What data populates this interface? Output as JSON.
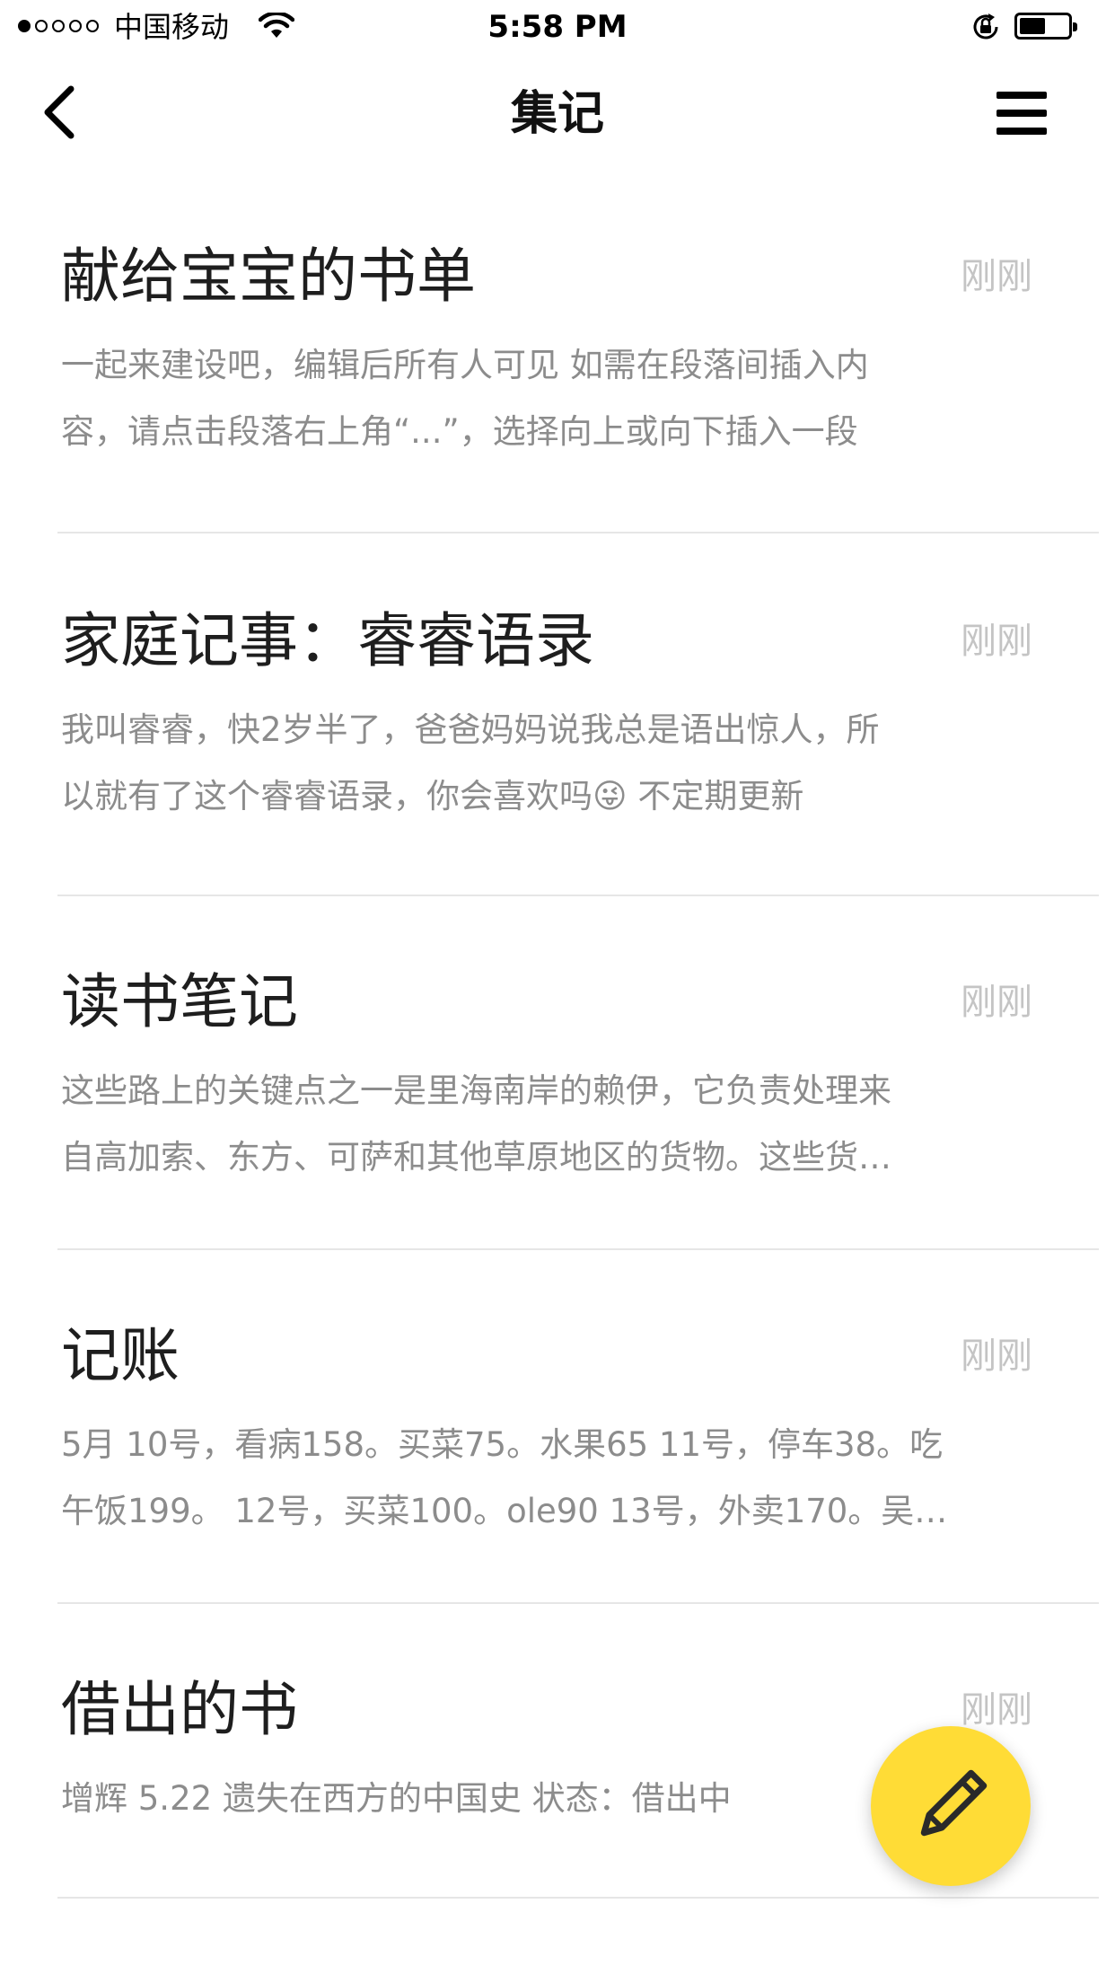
{
  "status_bar": {
    "carrier": "中国移动",
    "time": "5:58 PM"
  },
  "nav": {
    "title": "集记"
  },
  "notes": [
    {
      "title": "献给宝宝的书单",
      "time": "刚刚",
      "excerpt_lines": [
        "一起来建设吧，编辑后所有人可见 如需在段落间插入内",
        "容，请点击段落右上角“...”，选择向上或向下插入一段"
      ]
    },
    {
      "title": "家庭记事：睿睿语录",
      "time": "刚刚",
      "excerpt_lines": [
        "我叫睿睿，快2岁半了，爸爸妈妈说我总是语出惊人，所",
        "以就有了这个睿睿语录，你会喜欢吗😜 不定期更新"
      ]
    },
    {
      "title": "读书笔记",
      "time": "刚刚",
      "excerpt_lines": [
        "这些路上的关键点之一是里海南岸的赖伊，它负责处理来",
        "自高加索、东方、可萨和其他草原地区的货物。这些货…"
      ]
    },
    {
      "title": "记账",
      "time": "刚刚",
      "excerpt_lines": [
        "5月 10号，看病158。买菜75。水果65 11号，停车38。吃",
        "午饭199。 12号，买菜100。ole90 13号，外卖170。吴…"
      ]
    },
    {
      "title": "借出的书",
      "time": "刚刚",
      "excerpt_lines": [
        "增辉 5.22 遗失在西方的中国史 状态：借出中"
      ]
    }
  ],
  "icons": {
    "back": "chevron-left-icon",
    "menu": "hamburger-menu-icon",
    "compose": "pencil-icon",
    "wifi": "wifi-icon",
    "orientation_lock": "orientation-lock-icon",
    "battery": "battery-icon"
  },
  "colors": {
    "accent": "#ffdc36",
    "title_text": "#1e1e1e",
    "excerpt_text": "#8c8c8c",
    "time_text": "#c4c4c4",
    "divider": "#e6e6e6"
  }
}
